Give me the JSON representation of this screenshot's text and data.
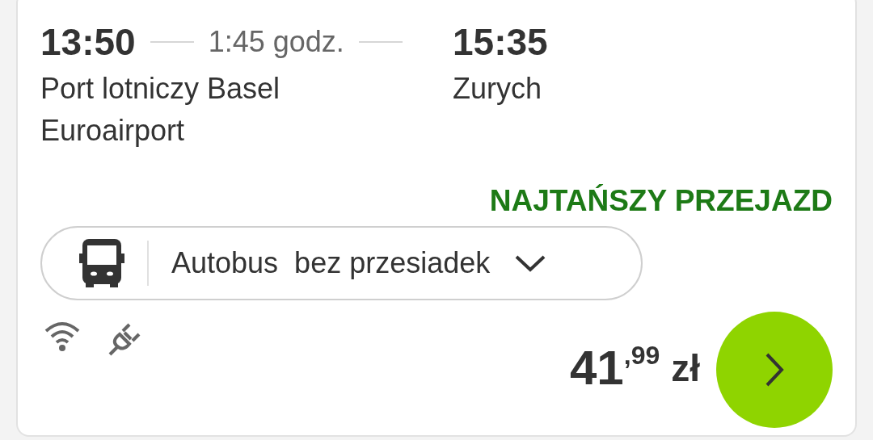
{
  "trip": {
    "departure_time": "13:50",
    "duration": "1:45 godz.",
    "arrival_time": "15:35",
    "departure_place": "Port lotniczy Basel Euroairport",
    "arrival_place": "Zurych"
  },
  "badge": "NAJTAŃSZY PRZEJAZD",
  "transport": {
    "label": "Autobus  bez przesiadek",
    "expanded": false
  },
  "price": {
    "main": "41",
    "fraction": ",99",
    "currency": "zł"
  }
}
